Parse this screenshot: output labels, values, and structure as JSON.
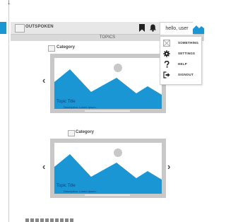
{
  "header": {
    "brand": "OUTSPOKEN",
    "greeting": "hello, user",
    "topics_label": "TOPICS"
  },
  "user_menu": {
    "items": [
      {
        "label": "SOMETHING",
        "icon": "image-placeholder-icon"
      },
      {
        "label": "SETTINGS",
        "icon": "gear-icon"
      },
      {
        "label": "HELP",
        "icon": "question-icon"
      },
      {
        "label": "SIGNOUT",
        "icon": "signout-icon"
      }
    ]
  },
  "cards": [
    {
      "category": "Category",
      "title": "Topic Title",
      "description": "Description. Lorem Ipsum."
    },
    {
      "category": "Category",
      "title": "Topic Title",
      "description": "Description. Lorem Ipsum."
    }
  ],
  "colors": {
    "accent": "#1a96d4",
    "header_bg": "#e7e7e7",
    "card_bg": "#c8c8c8",
    "caption": "#1a3d7a"
  }
}
